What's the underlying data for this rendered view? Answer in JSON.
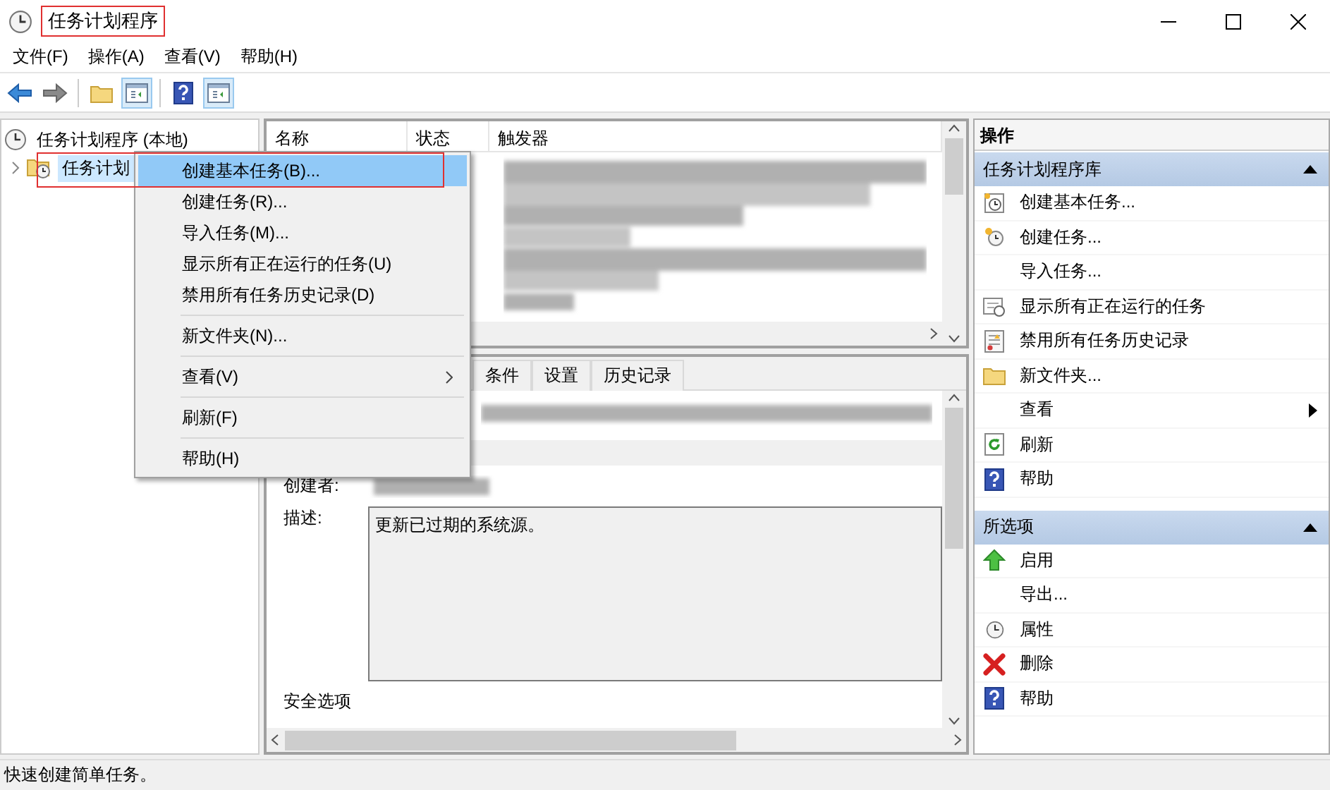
{
  "window": {
    "title": "任务计划程序"
  },
  "menu_bar": [
    "文件(F)",
    "操作(A)",
    "查看(V)",
    "帮助(H)"
  ],
  "tree": [
    {
      "label": "任务计划程序 (本地)",
      "selected": false,
      "children": [
        {
          "label": "任务计划",
          "selected": true,
          "expanded": false
        }
      ]
    }
  ],
  "task_list": {
    "columns": [
      "名称",
      "状态",
      "触发器"
    ]
  },
  "detail": {
    "tabs": [
      {
        "label": "条件",
        "selected": false
      },
      {
        "label": "设置",
        "selected": false
      },
      {
        "label": "历史记录",
        "selected": false
      }
    ],
    "creator_label": "创建者:",
    "description_label": "描述:",
    "description": "更新已过期的系统源。",
    "security_label": "安全选项"
  },
  "context_menu": [
    {
      "kind": "item",
      "label": "创建基本任务(B)...",
      "selected": true
    },
    {
      "kind": "item",
      "label": "创建任务(R)...",
      "selected": false
    },
    {
      "kind": "item",
      "label": "导入任务(M)...",
      "selected": false
    },
    {
      "kind": "item",
      "label": "显示所有正在运行的任务(U)",
      "selected": false
    },
    {
      "kind": "item",
      "label": "禁用所有任务历史记录(D)",
      "selected": false
    },
    {
      "kind": "separator"
    },
    {
      "kind": "item",
      "label": "新文件夹(N)...",
      "selected": false
    },
    {
      "kind": "separator"
    },
    {
      "kind": "item",
      "label": "查看(V)",
      "selected": false,
      "submenu": true
    },
    {
      "kind": "separator"
    },
    {
      "kind": "item",
      "label": "刷新(F)",
      "selected": false
    },
    {
      "kind": "separator"
    },
    {
      "kind": "item",
      "label": "帮助(H)",
      "selected": false
    }
  ],
  "actions": {
    "title": "操作",
    "sections": [
      {
        "title": "任务计划程序库",
        "expanded": true,
        "items": [
          {
            "label": "创建基本任务..."
          },
          {
            "label": "创建任务..."
          },
          {
            "label": "导入任务..."
          },
          {
            "label": "显示所有正在运行的任务"
          },
          {
            "label": "禁用所有任务历史记录"
          },
          {
            "label": "新文件夹..."
          },
          {
            "label": "查看",
            "submenu": true
          },
          {
            "label": "刷新"
          },
          {
            "label": "帮助"
          }
        ]
      },
      {
        "title": "所选项",
        "expanded": true,
        "items": [
          {
            "label": "启用"
          },
          {
            "label": "导出..."
          },
          {
            "label": "属性"
          },
          {
            "label": "删除"
          },
          {
            "label": "帮助"
          }
        ]
      }
    ]
  },
  "status_bar": "快速创建简单任务。"
}
